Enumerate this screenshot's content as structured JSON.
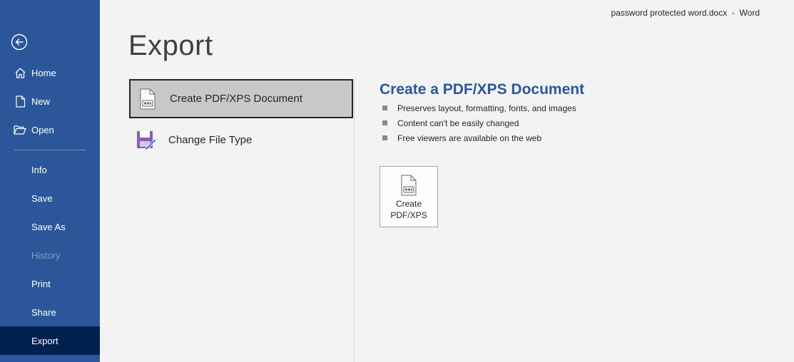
{
  "window": {
    "title": "password protected word.docx  -  Word"
  },
  "sidebar": {
    "back_icon": "back-arrow-icon",
    "items": [
      {
        "label": "Home",
        "icon": "home-icon"
      },
      {
        "label": "New",
        "icon": "new-document-icon"
      },
      {
        "label": "Open",
        "icon": "open-folder-icon"
      },
      {
        "label": "Info"
      },
      {
        "label": "Save"
      },
      {
        "label": "Save As"
      },
      {
        "label": "History",
        "disabled": true
      },
      {
        "label": "Print"
      },
      {
        "label": "Share"
      },
      {
        "label": "Export",
        "active": true
      }
    ],
    "colors": {
      "background": "#2b579a",
      "active": "#002050",
      "disabled_text": "#7f9cc8"
    }
  },
  "main": {
    "title": "Export",
    "options": [
      {
        "label": "Create PDF/XPS Document",
        "icon": "pdf-document-icon",
        "selected": true
      },
      {
        "label": "Change File Type",
        "icon": "change-file-type-icon",
        "selected": false
      }
    ]
  },
  "detail": {
    "title": "Create a PDF/XPS Document",
    "bullets": [
      "Preserves layout, formatting, fonts, and images",
      "Content can't be easily changed",
      "Free viewers are available on the web"
    ],
    "button": {
      "line1": "Create",
      "line2": "PDF/XPS",
      "icon": "pdf-document-icon"
    },
    "colors": {
      "title": "#2b579a"
    }
  }
}
